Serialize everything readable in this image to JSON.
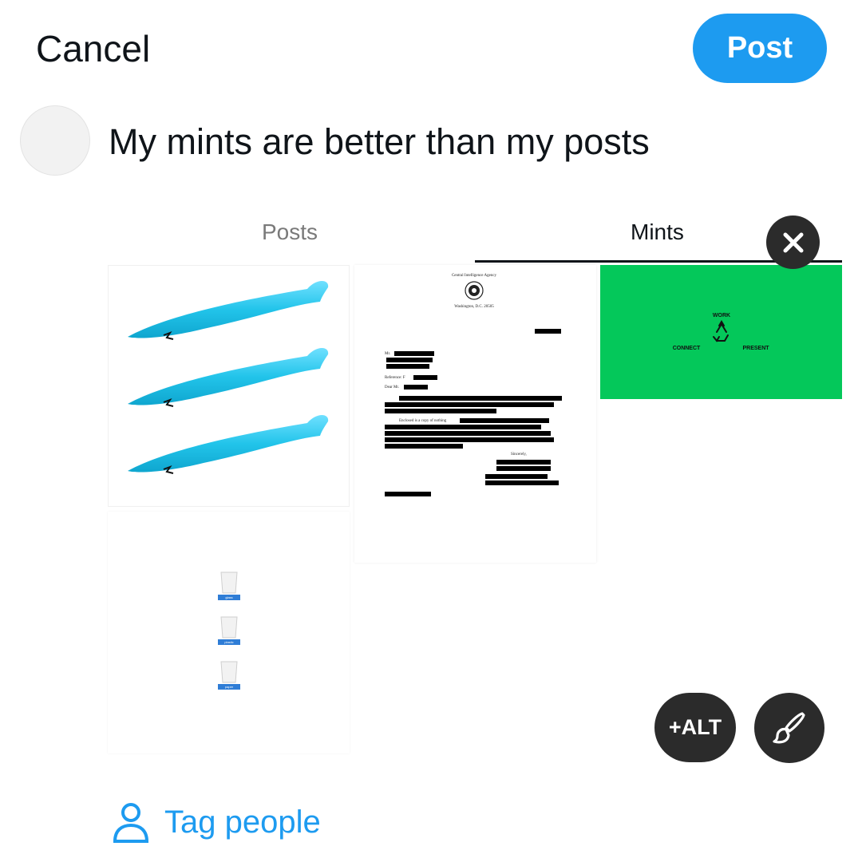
{
  "header": {
    "cancel_label": "Cancel",
    "post_label": "Post"
  },
  "compose": {
    "text": "My mints are better than my posts"
  },
  "media": {
    "tabs": [
      {
        "label": "Posts",
        "selected": false
      },
      {
        "label": "Mints",
        "selected": true
      }
    ],
    "letter": {
      "agency": "Central Intelligence Agency",
      "address": "Washington, D.C. 20505",
      "salutation_to": "Mr.",
      "reference": "Reference: F",
      "dear": "Dear Mr.",
      "body": "Enclosed is a copy of nothing",
      "closing": "Sincerely,"
    },
    "green_tile": {
      "top": "WORK",
      "left": "CONNECT",
      "right": "PRESENT",
      "icon": "recycle-icon",
      "color": "#04c85a"
    },
    "cups": [
      "glass",
      "plastic",
      "paper"
    ]
  },
  "actions": {
    "alt_label": "+ALT",
    "edit_icon": "paintbrush-icon",
    "close_icon": "close-icon"
  },
  "tag": {
    "label": "Tag people",
    "icon": "person-icon"
  },
  "colors": {
    "accent": "#1d9bf0",
    "overlay_button": "#2b2b2b"
  }
}
